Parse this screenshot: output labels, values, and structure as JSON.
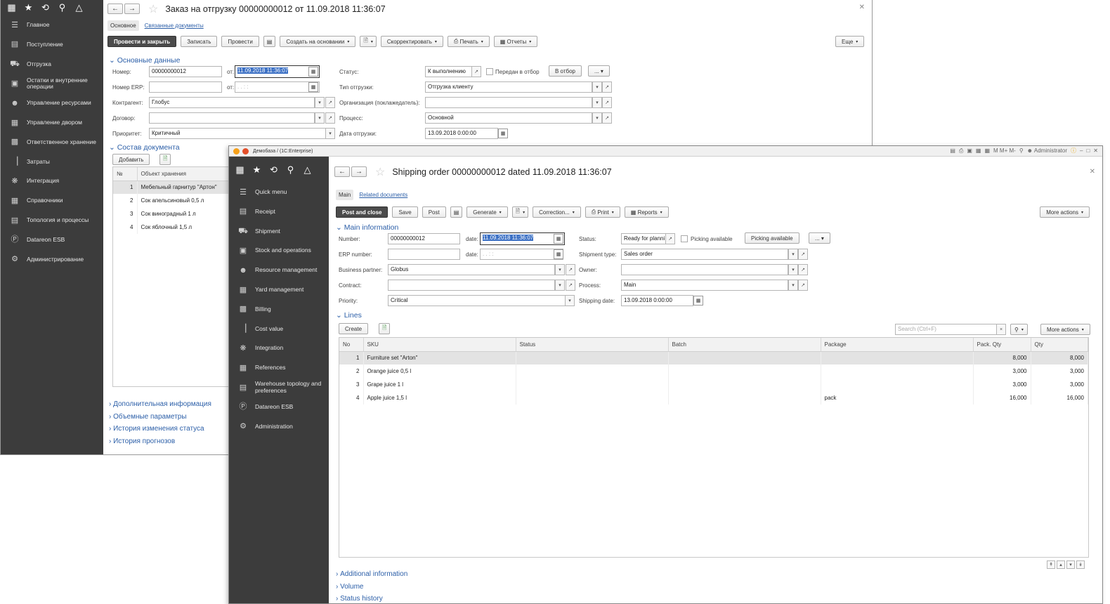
{
  "ru": {
    "sidebar_top_icons": [
      "apps-icon",
      "star-icon",
      "history-icon",
      "search-icon",
      "bell-icon"
    ],
    "sidebar": [
      {
        "label": "Главное",
        "icon": "menu-icon"
      },
      {
        "label": "Поступление",
        "icon": "receipt-icon"
      },
      {
        "label": "Отгрузка",
        "icon": "truck-icon"
      },
      {
        "label": "Остатки и внутренние операции",
        "icon": "stock-icon"
      },
      {
        "label": "Управление ресурсами",
        "icon": "person-icon"
      },
      {
        "label": "Управление двором",
        "icon": "yard-icon"
      },
      {
        "label": "Ответственное хранение",
        "icon": "storage-icon"
      },
      {
        "label": "Затраты",
        "icon": "bar-chart-icon"
      },
      {
        "label": "Интеграция",
        "icon": "integration-icon"
      },
      {
        "label": "Справочники",
        "icon": "references-icon"
      },
      {
        "label": "Топология и процессы",
        "icon": "topology-icon"
      },
      {
        "label": "Datareon ESB",
        "icon": "d-circle-icon"
      },
      {
        "label": "Администрирование",
        "icon": "gear-icon"
      }
    ],
    "title": "Заказ на отгрузку 00000000012 от 11.09.2018 11:36:07",
    "tab_main": "Основное",
    "tab_related": "Связанные документы",
    "toolbar": {
      "post_close": "Провести и закрыть",
      "save": "Записать",
      "post": "Провести",
      "create_based": "Создать на основании",
      "correct": "Скорректировать",
      "print": "Печать",
      "reports": "Отчеты",
      "more": "Еще"
    },
    "group_main": "Основные данные",
    "labels": {
      "number": "Номер:",
      "date": "от:",
      "erp": "Номер ERP:",
      "date2": "от:",
      "partner": "Контрагент:",
      "contract": "Договор:",
      "priority": "Приоритет:",
      "status": "Статус:",
      "ship_type": "Тип отгрузки:",
      "owner": "Организация (поклажедатель):",
      "process": "Процесс:",
      "ship_date": "Дата отгрузки:"
    },
    "values": {
      "number": "00000000012",
      "date": "11.09.2018 11:36:07",
      "erp_date": " .  .       :  :",
      "partner": "Глобус",
      "priority": "Критичный",
      "status": "К выполнению",
      "picking_flag": "Передан в отбор",
      "picking_btn": "В отбор",
      "ship_type": "Отгрузка клиенту",
      "process": "Основной",
      "ship_date": "13.09.2018  0:00:00"
    },
    "group_lines": "Состав документа",
    "add_btn": "Добавить",
    "grid_headers": [
      "№",
      "Объект хранения"
    ],
    "rows": [
      {
        "n": "1",
        "sku": "Мебельный гарнитур \"Артон\""
      },
      {
        "n": "2",
        "sku": "Сок апельсиновый 0,5 л"
      },
      {
        "n": "3",
        "sku": "Сок виноградный 1 л"
      },
      {
        "n": "4",
        "sku": "Сок яблочный 1,5 л"
      }
    ],
    "sections": [
      "Дополнительная информация",
      "Объемные параметры",
      "История изменения статуса",
      "История прогнозов"
    ]
  },
  "en": {
    "strip_title": "Демобаза / (1С:Enterprise)",
    "strip_user": "Administrator",
    "sidebar_top_icons": [
      "apps-icon",
      "star-icon",
      "history-icon",
      "search-icon",
      "bell-icon"
    ],
    "sidebar": [
      {
        "label": "Quick menu",
        "icon": "menu-icon"
      },
      {
        "label": "Receipt",
        "icon": "receipt-icon"
      },
      {
        "label": "Shipment",
        "icon": "truck-icon"
      },
      {
        "label": "Stock and operations",
        "icon": "stock-icon"
      },
      {
        "label": "Resource management",
        "icon": "person-icon"
      },
      {
        "label": "Yard management",
        "icon": "yard-icon"
      },
      {
        "label": "Billing",
        "icon": "storage-icon"
      },
      {
        "label": "Cost value",
        "icon": "bar-chart-icon"
      },
      {
        "label": "Integration",
        "icon": "integration-icon"
      },
      {
        "label": "References",
        "icon": "references-icon"
      },
      {
        "label": "Warehouse topology and preferences",
        "icon": "topology-icon"
      },
      {
        "label": "Datareon ESB",
        "icon": "d-circle-icon"
      },
      {
        "label": "Administration",
        "icon": "gear-icon"
      }
    ],
    "title": "Shipping order 00000000012 dated 11.09.2018 11:36:07",
    "tab_main": "Main",
    "tab_related": "Related documents",
    "toolbar": {
      "post_close": "Post and close",
      "save": "Save",
      "post": "Post",
      "generate": "Generate",
      "correction": "Correction...",
      "print": "Print",
      "reports": "Reports",
      "more": "More actions"
    },
    "group_main": "Main information",
    "labels": {
      "number": "Number:",
      "date": "date:",
      "erp": "ERP number:",
      "date2": "date:",
      "partner": "Business partner:",
      "contract": "Contract:",
      "priority": "Priority:",
      "status": "Status:",
      "ship_type": "Shipment type:",
      "owner": "Owner:",
      "process": "Process:",
      "ship_date": "Shipping date:"
    },
    "values": {
      "number": "00000000012",
      "date": "11.09.2018 11:36:07",
      "erp_date": " .  .       :  :",
      "partner": "Globus",
      "priority": "Critical",
      "status": "Ready for planni",
      "picking_flag": "Picking available",
      "picking_btn": "Picking available",
      "ship_type": "Sales order",
      "process": "Main",
      "ship_date": "13.09.2018  0:00:00"
    },
    "group_lines": "Lines",
    "create_btn": "Create",
    "search_placeholder": "Search (Ctrl+F)",
    "more_actions": "More actions",
    "grid_headers": [
      "No",
      "SKU",
      "Status",
      "Batch",
      "Package",
      "Pack. Qty",
      "Qty"
    ],
    "rows": [
      {
        "n": "1",
        "sku": "Furniture set \"Arton\"",
        "status": "",
        "batch": "",
        "package": "",
        "pack_qty": "8,000",
        "qty": "8,000"
      },
      {
        "n": "2",
        "sku": "Orange juice 0,5 l",
        "status": "",
        "batch": "",
        "package": "",
        "pack_qty": "3,000",
        "qty": "3,000"
      },
      {
        "n": "3",
        "sku": "Grape juice 1 l",
        "status": "",
        "batch": "",
        "package": "",
        "pack_qty": "3,000",
        "qty": "3,000"
      },
      {
        "n": "4",
        "sku": "Apple juice 1,5 l",
        "status": "",
        "batch": "",
        "package": "pack",
        "pack_qty": "16,000",
        "qty": "16,000"
      }
    ],
    "sections": [
      "Additional information",
      "Volume",
      "Status history"
    ]
  }
}
